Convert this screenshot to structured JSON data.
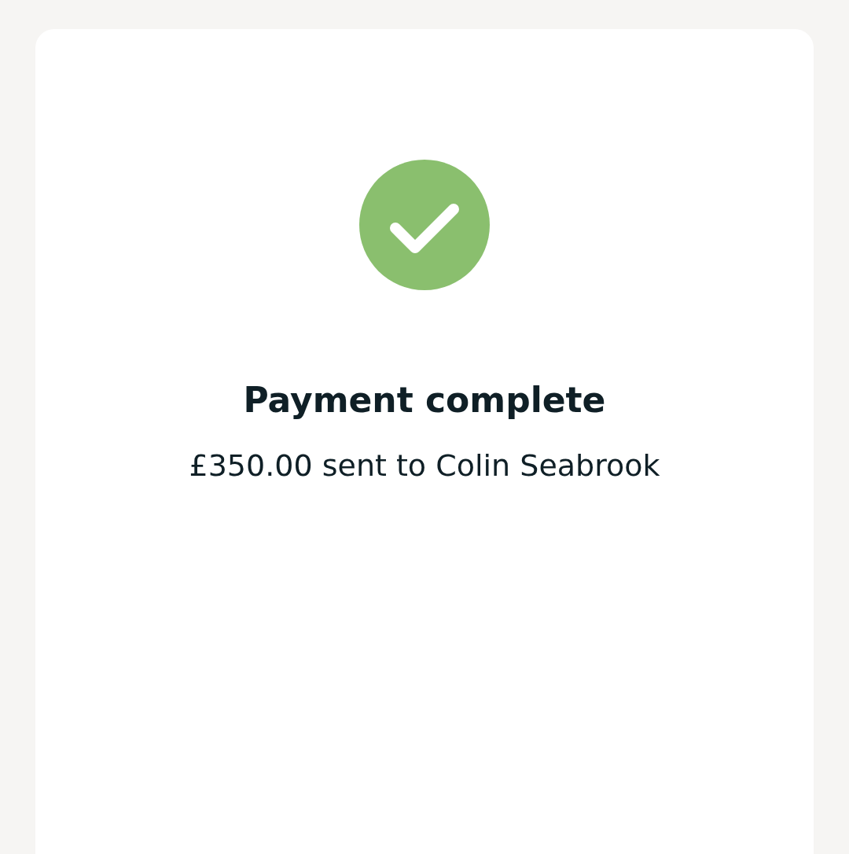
{
  "status": {
    "kind": "success",
    "title": "Payment complete",
    "message": "£350.00 sent to Colin Seabrook"
  }
}
